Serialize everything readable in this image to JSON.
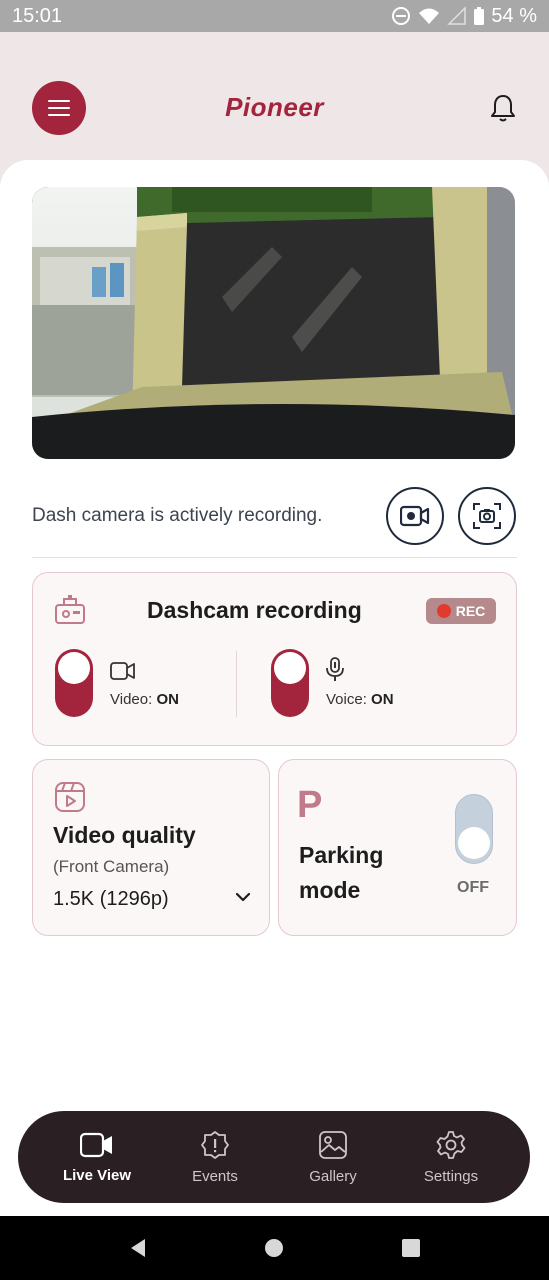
{
  "status_bar": {
    "time": "15:01",
    "battery_text": "54 %"
  },
  "header": {
    "brand": "Pioneer"
  },
  "live_view": {
    "alt": "live camera feed"
  },
  "recording_status": "Dash camera is actively recording.",
  "dashcam_card": {
    "title": "Dashcam recording",
    "badge": "REC",
    "video_label": "Video: ",
    "video_state": "ON",
    "voice_label": "Voice: ",
    "voice_state": "ON"
  },
  "quality_card": {
    "title": "Video quality",
    "subtitle": "(Front Camera)",
    "value": "1.5K  (1296p)"
  },
  "parking_card": {
    "letter": "P",
    "title_line1": "Parking",
    "title_line2": "mode",
    "state": "OFF"
  },
  "bottom_nav": [
    {
      "label": "Live View",
      "icon": "video-icon",
      "active": true
    },
    {
      "label": "Events",
      "icon": "alert-icon",
      "active": false
    },
    {
      "label": "Gallery",
      "icon": "image-icon",
      "active": false
    },
    {
      "label": "Settings",
      "icon": "gear-icon",
      "active": false
    }
  ],
  "colors": {
    "accent": "#a3243d",
    "nav_bg": "#2a1f22",
    "rec_dot": "#e33a2f"
  }
}
